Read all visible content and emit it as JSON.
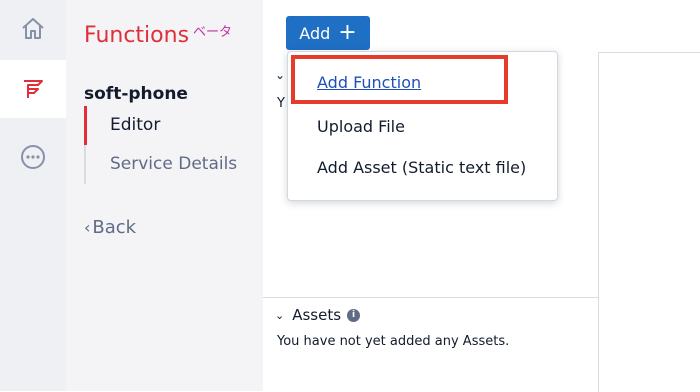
{
  "rail": {
    "items": [
      {
        "icon": "home-icon"
      },
      {
        "icon": "functions-icon"
      },
      {
        "icon": "more-icon"
      }
    ]
  },
  "nav": {
    "title": "Functions",
    "beta": "ベータ",
    "service_name": "soft-phone",
    "items": [
      {
        "label": "Editor",
        "active": true
      },
      {
        "label": "Service Details",
        "active": false
      }
    ],
    "back_label": "Back"
  },
  "main": {
    "add_button_label": "Add",
    "functions_truncated_text": "Y",
    "assets": {
      "title": "Assets",
      "empty_text": "You have not yet added any Assets."
    }
  },
  "dropdown": {
    "items": [
      {
        "label": "Add Function"
      },
      {
        "label": "Upload File"
      },
      {
        "label": "Add Asset (Static text file)"
      }
    ]
  },
  "colors": {
    "brand_red": "#e02f3a",
    "primary_blue": "#1f6fc5",
    "link_blue": "#1f4fb8",
    "highlight": "#e53b2a"
  }
}
